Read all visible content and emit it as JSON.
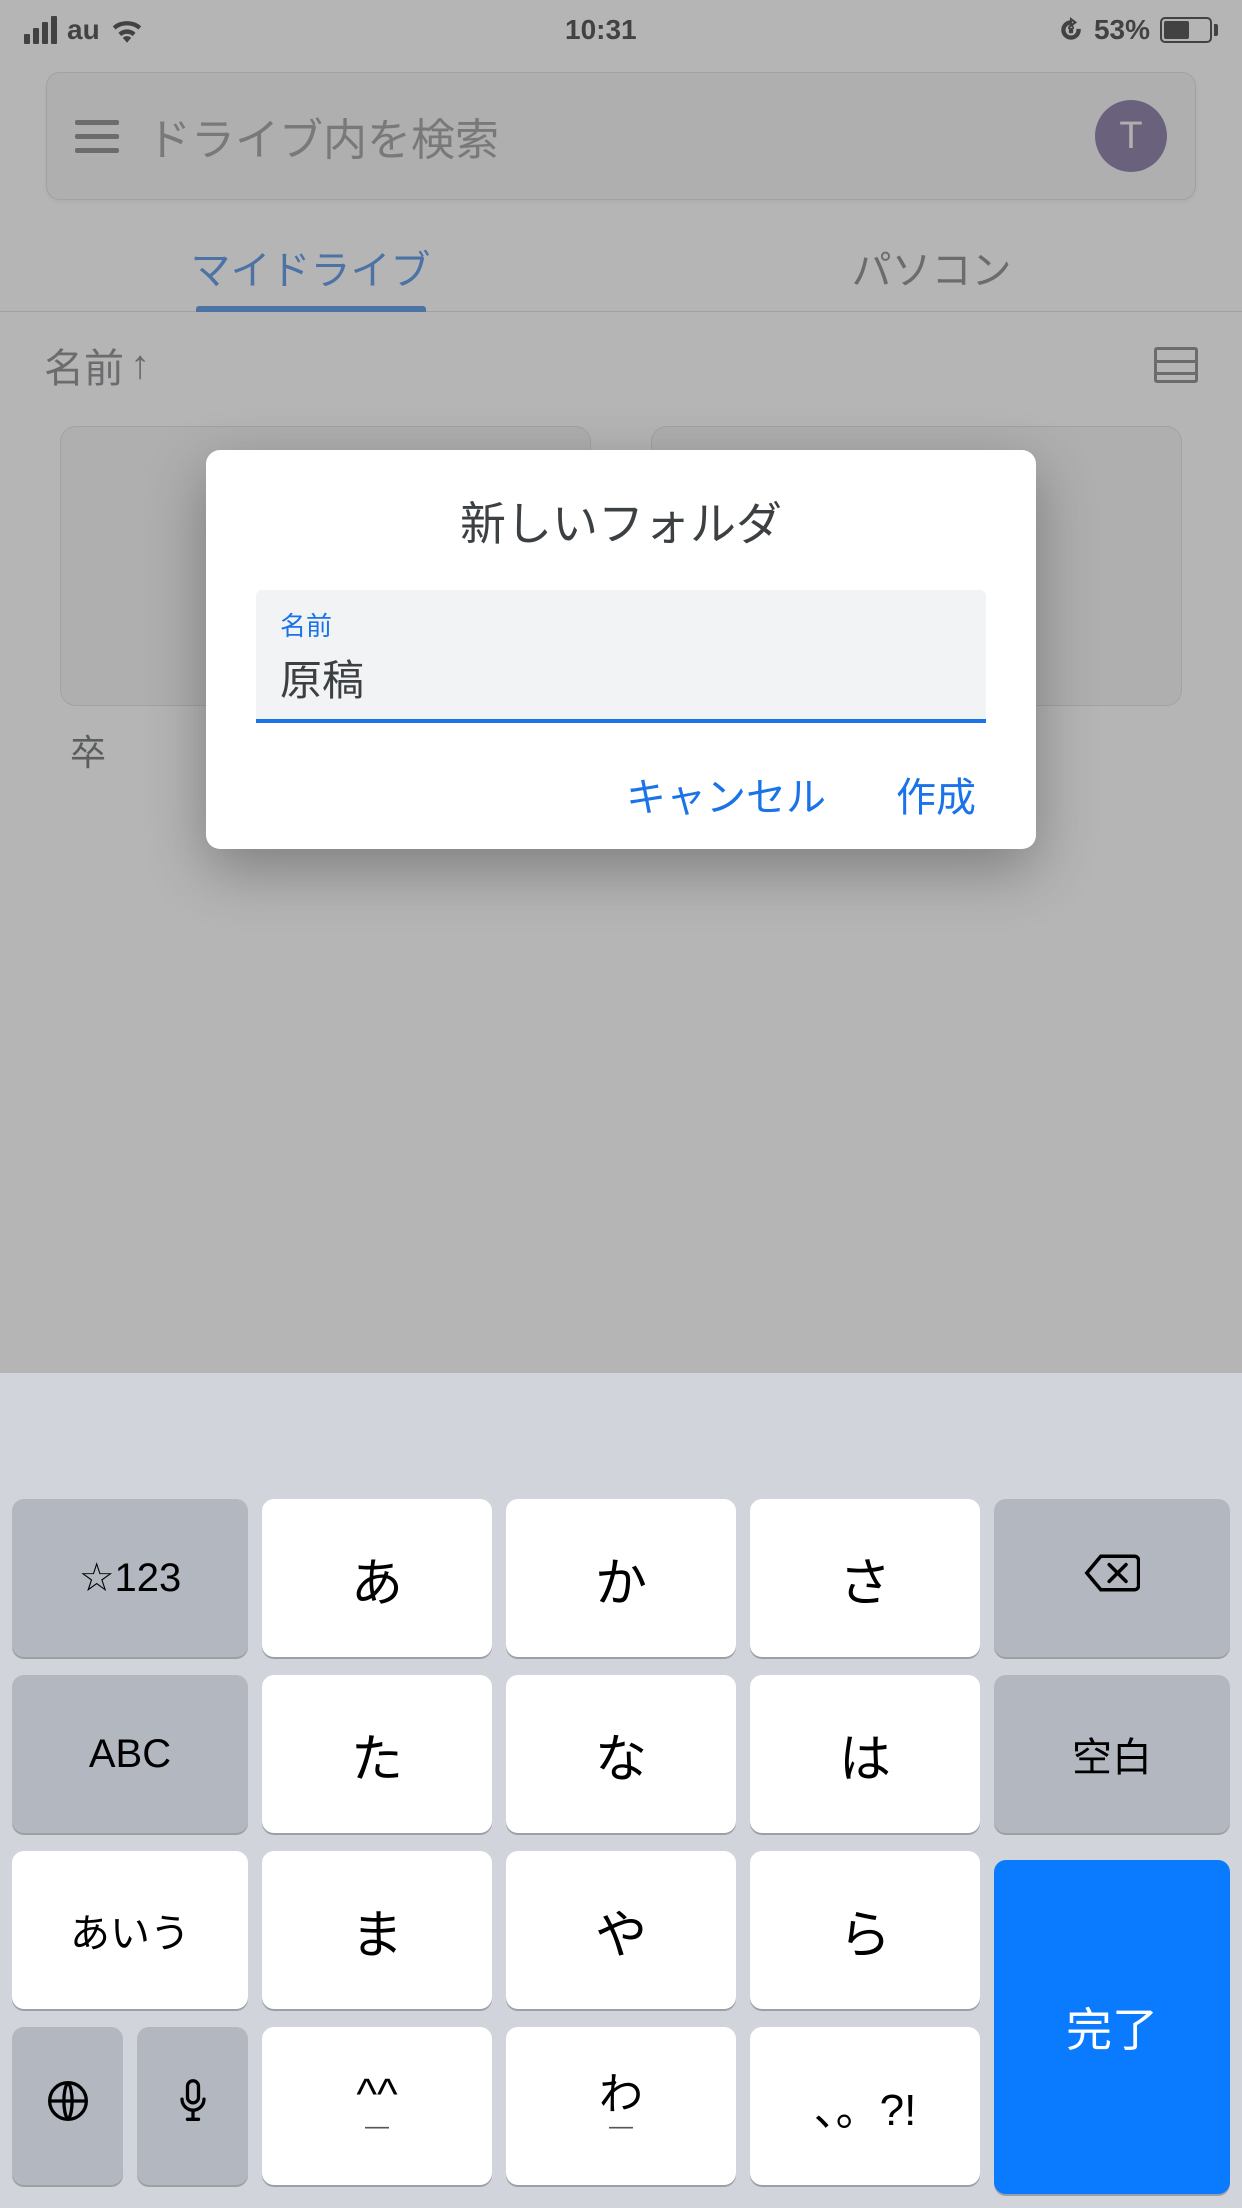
{
  "status": {
    "carrier": "au",
    "time": "10:31",
    "battery_pct": "53%"
  },
  "header": {
    "search_placeholder": "ドライブ内を検索",
    "avatar_initial": "T"
  },
  "tabs": {
    "my_drive": "マイドライブ",
    "computers": "パソコン"
  },
  "sort": {
    "label": "名前",
    "arrow": "↑"
  },
  "files": {
    "item1_title": "卒"
  },
  "dialog": {
    "title": "新しいフォルダ",
    "input_label": "名前",
    "input_value": "原稿",
    "cancel": "キャンセル",
    "create": "作成"
  },
  "keyboard": {
    "mode": "☆123",
    "abc": "ABC",
    "kana_switch": "あいう",
    "space": "空白",
    "done": "完了",
    "rows": {
      "r1": [
        "あ",
        "か",
        "さ"
      ],
      "r2": [
        "た",
        "な",
        "は"
      ],
      "r3": [
        "ま",
        "や",
        "ら"
      ],
      "r4_left": "^^",
      "r4_center": "わ",
      "r4_right": "、。?!"
    }
  }
}
